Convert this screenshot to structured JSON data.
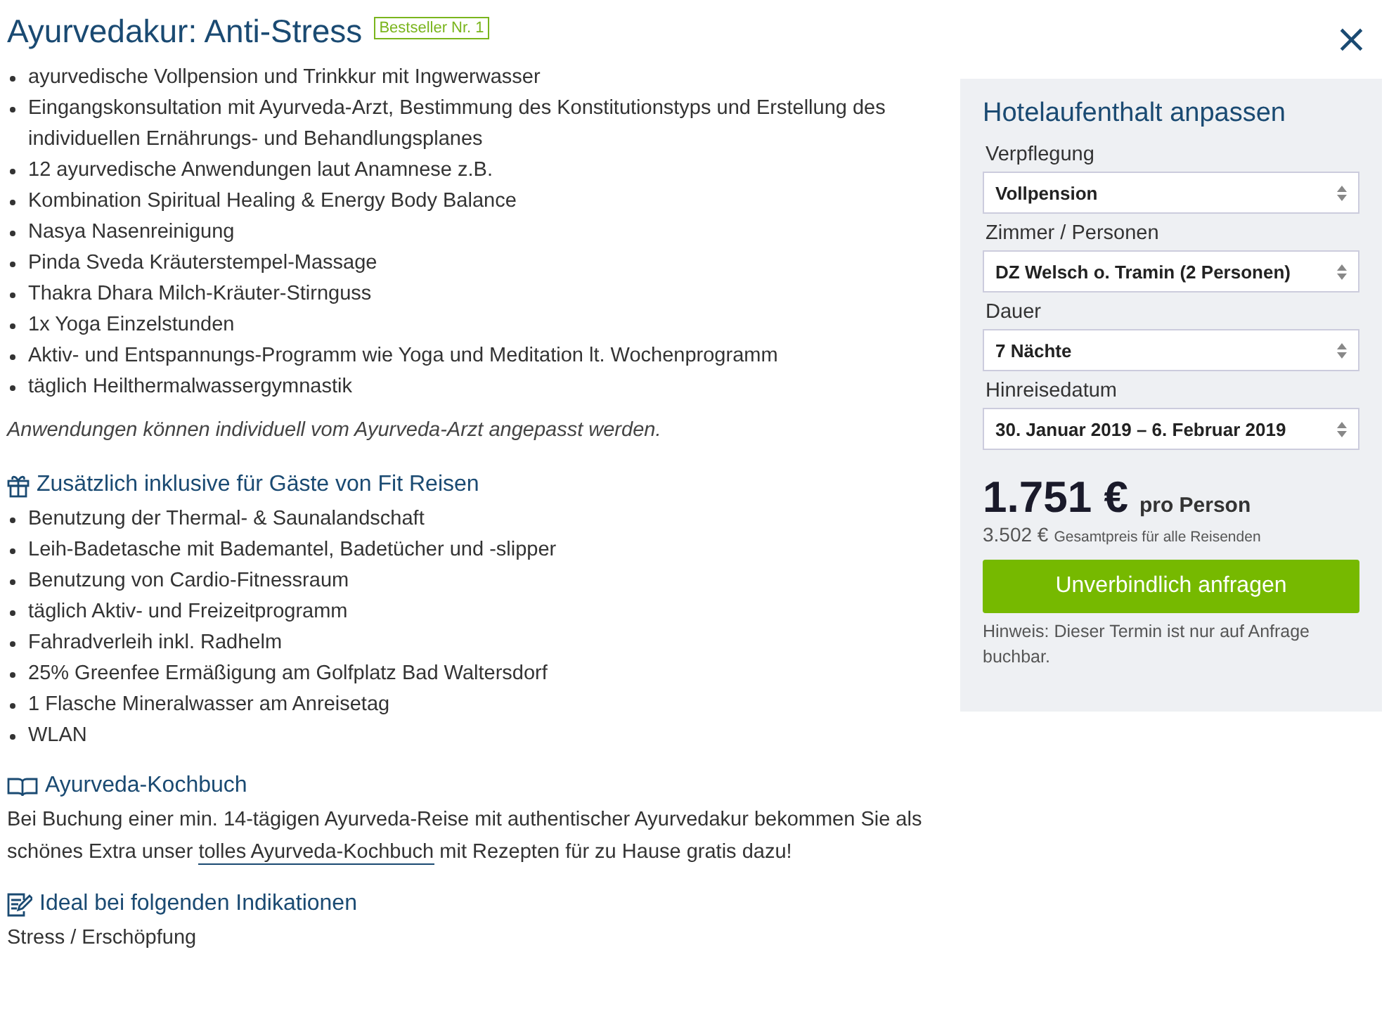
{
  "title": "Ayurvedakur: Anti-Stress",
  "badge": "Bestseller Nr. 1",
  "close": "×",
  "features": [
    "ayurvedische Vollpension und Trinkkur mit Ingwerwasser",
    "Eingangskonsultation mit Ayurveda-Arzt, Bestimmung des Konstitutionstyps und Erstellung des individuellen Ernährungs- und Behandlungsplanes",
    "12 ayurvedische Anwendungen laut Anamnese z.B.",
    "Kombination Spiritual Healing & Energy Body Balance",
    "Nasya Nasenreinigung",
    "Pinda Sveda Kräuterstempel-Massage",
    "Thakra Dhara Milch-Kräuter-Stirnguss",
    "1x Yoga Einzelstunden",
    "Aktiv- und Entspannungs-Programm wie Yoga und Meditation lt. Wochenprogramm",
    "täglich Heilthermalwassergymnastik"
  ],
  "note": "Anwendungen können individuell vom Ayurveda-Arzt angepasst werden.",
  "sections": [
    {
      "kind": "gift",
      "heading": "Zusätzlich inklusive für Gäste von Fit Reisen",
      "items": [
        "Benutzung der Thermal- & Saunalandschaft",
        "Leih-Badetasche mit Bademantel, Badetücher und -slipper",
        "Benutzung von Cardio-Fitnessraum",
        "täglich Aktiv- und Freizeitprogramm",
        "Fahradverleih inkl. Radhelm",
        "25% Greenfee Ermäßigung am Golfplatz Bad Waltersdorf",
        "1 Flasche Mineralwasser am Anreisetag",
        "WLAN"
      ]
    },
    {
      "kind": "book",
      "heading": "Ayurveda-Kochbuch",
      "text_before": "Bei Buchung einer min. 14-tägigen Ayurveda-Reise mit authentischer Ayurvedakur bekommen Sie als schönes Extra unser ",
      "link": "tolles Ayurveda-Kochbuch",
      "text_after": " mit Rezepten für zu Hause gratis dazu!"
    },
    {
      "kind": "edit",
      "heading": "Ideal bei folgenden Indikationen",
      "text": "Stress / Erschöpfung"
    }
  ],
  "panel": {
    "title": "Hotelaufenthalt anpassen",
    "fields": [
      {
        "label": "Verpflegung",
        "value": "Vollpension"
      },
      {
        "label": "Zimmer / Personen",
        "value": "DZ Welsch o. Tramin (2 Personen)"
      },
      {
        "label": "Dauer",
        "value": "7 Nächte"
      },
      {
        "label": "Hinreisedatum",
        "value": "30. Januar 2019 – 6. Februar 2019"
      }
    ],
    "price": "1.751 €",
    "price_unit": "pro Person",
    "total": "3.502 €",
    "total_label": "Gesamtpreis für alle Reisenden",
    "button": "Unverbindlich anfragen",
    "hint": "Hinweis: Dieser Termin ist nur auf Anfrage buchbar."
  }
}
